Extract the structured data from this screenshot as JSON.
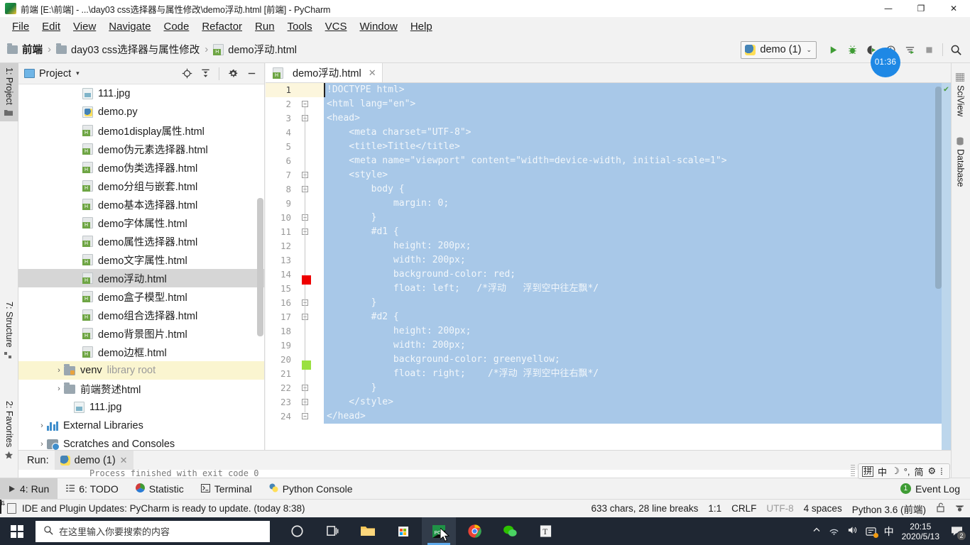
{
  "window": {
    "title": "前端 [E:\\前端] - ...\\day03 css选择器与属性修改\\demo浮动.html [前端] - PyCharm",
    "app_icon": "pycharm-icon",
    "minimize": "—",
    "maximize": "❐",
    "close": "✕"
  },
  "menu": {
    "items": [
      {
        "label": "File"
      },
      {
        "label": "Edit"
      },
      {
        "label": "View"
      },
      {
        "label": "Navigate"
      },
      {
        "label": "Code"
      },
      {
        "label": "Refactor"
      },
      {
        "label": "Run"
      },
      {
        "label": "Tools"
      },
      {
        "label": "VCS"
      },
      {
        "label": "Window"
      },
      {
        "label": "Help"
      }
    ]
  },
  "breadcrumb": {
    "items": [
      {
        "label": "前端",
        "icon": "folder-icon"
      },
      {
        "label": "day03 css选择器与属性修改",
        "icon": "folder-icon"
      },
      {
        "label": "demo浮动.html",
        "icon": "html-file-icon"
      }
    ],
    "separator": "›"
  },
  "toolbar": {
    "run_config": "demo (1)",
    "run_config_caret": "⌄",
    "buttons": [
      "run-icon",
      "debug-icon",
      "coverage-icon",
      "profile-icon",
      "attach-icon",
      "stop-icon",
      "search-everywhere-icon"
    ],
    "timer_badge": "01:36"
  },
  "left_stripe": {
    "items": [
      {
        "label": "1: Project",
        "active": true
      },
      {
        "label": "7: Structure",
        "active": false
      },
      {
        "label": "2: Favorites",
        "active": false
      }
    ]
  },
  "right_stripe": {
    "items": [
      {
        "label": "SciView"
      },
      {
        "label": "Database"
      }
    ]
  },
  "project_panel": {
    "title": "Project",
    "caret": "▾",
    "actions": [
      "locate-icon",
      "collapse-all-icon",
      "settings-icon",
      "hide-icon"
    ],
    "tree": [
      {
        "label": "111.jpg",
        "icon": "image-file-icon",
        "indent": 3,
        "arrow": "",
        "state": "normal"
      },
      {
        "label": "demo.py",
        "icon": "python-file-icon",
        "indent": 3,
        "arrow": "",
        "state": "normal"
      },
      {
        "label": "demo1display属性.html",
        "icon": "html-file-icon",
        "indent": 3,
        "arrow": "",
        "state": "normal"
      },
      {
        "label": "demo伪元素选择器.html",
        "icon": "html-file-icon",
        "indent": 3,
        "arrow": "",
        "state": "normal"
      },
      {
        "label": "demo伪类选择器.html",
        "icon": "html-file-icon",
        "indent": 3,
        "arrow": "",
        "state": "normal"
      },
      {
        "label": "demo分组与嵌套.html",
        "icon": "html-file-icon",
        "indent": 3,
        "arrow": "",
        "state": "normal"
      },
      {
        "label": "demo基本选择器.html",
        "icon": "html-file-icon",
        "indent": 3,
        "arrow": "",
        "state": "normal"
      },
      {
        "label": "demo字体属性.html",
        "icon": "html-file-icon",
        "indent": 3,
        "arrow": "",
        "state": "normal"
      },
      {
        "label": "demo属性选择器.html",
        "icon": "html-file-icon",
        "indent": 3,
        "arrow": "",
        "state": "normal"
      },
      {
        "label": "demo文字属性.html",
        "icon": "html-file-icon",
        "indent": 3,
        "arrow": "",
        "state": "normal"
      },
      {
        "label": "demo浮动.html",
        "icon": "html-file-icon",
        "indent": 3,
        "arrow": "",
        "state": "selected"
      },
      {
        "label": "demo盒子模型.html",
        "icon": "html-file-icon",
        "indent": 3,
        "arrow": "",
        "state": "normal"
      },
      {
        "label": "demo组合选择器.html",
        "icon": "html-file-icon",
        "indent": 3,
        "arrow": "",
        "state": "normal"
      },
      {
        "label": "demo背景图片.html",
        "icon": "html-file-icon",
        "indent": 3,
        "arrow": "",
        "state": "normal"
      },
      {
        "label": "demo边框.html",
        "icon": "html-file-icon",
        "indent": 3,
        "arrow": "",
        "state": "normal"
      },
      {
        "label": "venv",
        "suffix": "library root",
        "icon": "folder-src-icon",
        "indent": 2,
        "arrow": "›",
        "state": "highlight"
      },
      {
        "label": "前端赘述html",
        "icon": "folder-icon",
        "indent": 2,
        "arrow": "›",
        "state": "normal"
      },
      {
        "label": "111.jpg",
        "icon": "image-file-icon",
        "indent": 3,
        "arrow": "",
        "state": "normal"
      },
      {
        "label": "External Libraries",
        "icon": "library-icon",
        "indent": 1,
        "arrow": "›",
        "state": "normal"
      },
      {
        "label": "Scratches and Consoles",
        "icon": "scratches-icon",
        "indent": 1,
        "arrow": "›",
        "state": "normal"
      }
    ]
  },
  "editor": {
    "tab": {
      "label": "demo浮动.html",
      "icon": "html-file-icon",
      "close": "✕"
    },
    "current_line": 1,
    "gutter_swatches": [
      {
        "line": 14,
        "color": "#ee0000"
      },
      {
        "line": 20,
        "color": "#9ae040"
      }
    ],
    "inspection_status": "✔",
    "lines": [
      {
        "n": 1,
        "text": "!DOCTYPE html>",
        "fold": ""
      },
      {
        "n": 2,
        "text": "<html lang=\"en\">",
        "fold": "−"
      },
      {
        "n": 3,
        "text": "<head>",
        "fold": "−"
      },
      {
        "n": 4,
        "text": "    <meta charset=\"UTF-8\">",
        "fold": ""
      },
      {
        "n": 5,
        "text": "    <title>Title</title>",
        "fold": ""
      },
      {
        "n": 6,
        "text": "    <meta name=\"viewport\" content=\"width=device-width, initial-scale=1\">",
        "fold": ""
      },
      {
        "n": 7,
        "text": "    <style>",
        "fold": "−"
      },
      {
        "n": 8,
        "text": "        body {",
        "fold": "−"
      },
      {
        "n": 9,
        "text": "            margin: 0;",
        "fold": ""
      },
      {
        "n": 10,
        "text": "        }",
        "fold": "−"
      },
      {
        "n": 11,
        "text": "        #d1 {",
        "fold": "−"
      },
      {
        "n": 12,
        "text": "            height: 200px;",
        "fold": ""
      },
      {
        "n": 13,
        "text": "            width: 200px;",
        "fold": ""
      },
      {
        "n": 14,
        "text": "            background-color: red;",
        "fold": ""
      },
      {
        "n": 15,
        "text": "            float: left;   /*浮动   浮到空中往左飘*/",
        "fold": ""
      },
      {
        "n": 16,
        "text": "        }",
        "fold": "−"
      },
      {
        "n": 17,
        "text": "        #d2 {",
        "fold": "−"
      },
      {
        "n": 18,
        "text": "            height: 200px;",
        "fold": ""
      },
      {
        "n": 19,
        "text": "            width: 200px;",
        "fold": ""
      },
      {
        "n": 20,
        "text": "            background-color: greenyellow;",
        "fold": ""
      },
      {
        "n": 21,
        "text": "            float: right;    /*浮动 浮到空中往右飘*/",
        "fold": ""
      },
      {
        "n": 22,
        "text": "        }",
        "fold": "−"
      },
      {
        "n": 23,
        "text": "    </style>",
        "fold": "−"
      },
      {
        "n": 24,
        "text": "</head>",
        "fold": "−"
      }
    ]
  },
  "run_window": {
    "label": "Run:",
    "tab": "demo (1)",
    "tab_close": "✕",
    "console_text": "Process finished with exit code 0"
  },
  "bottom_stripe": {
    "items": [
      {
        "label": "4: Run",
        "icon": "run-small-icon",
        "active": true
      },
      {
        "label": "6: TODO",
        "icon": "todo-icon",
        "active": false
      },
      {
        "label": "Statistic",
        "icon": "statistic-icon",
        "active": false
      },
      {
        "label": "Terminal",
        "icon": "terminal-icon",
        "active": false
      },
      {
        "label": "Python Console",
        "icon": "python-icon",
        "active": false
      }
    ],
    "event_log": {
      "label": "Event Log",
      "count": "1"
    }
  },
  "ime_bar": {
    "items": [
      "拼",
      "中",
      "☽",
      "°,",
      "简",
      "⚙",
      "⁞"
    ]
  },
  "statusbar": {
    "message": "IDE and Plugin Updates: PyCharm is ready to update. (today 8:38)",
    "chars": "633 chars, 28 line breaks",
    "caret_pos": "1:1",
    "line_sep": "CRLF",
    "encoding": "UTF-8",
    "indent": "4 spaces",
    "interpreter": "Python 3.6 (前端)",
    "lock_icon": "unlock-icon",
    "hector_icon": "hector-icon"
  },
  "taskbar": {
    "search_placeholder": "在这里输入你要搜索的内容",
    "apps": [
      {
        "name": "cortana-icon"
      },
      {
        "name": "task-view-icon"
      },
      {
        "name": "file-explorer-icon"
      },
      {
        "name": "microsoft-store-icon"
      },
      {
        "name": "pycharm-icon"
      },
      {
        "name": "chrome-icon"
      },
      {
        "name": "wechat-icon"
      },
      {
        "name": "typora-icon"
      }
    ],
    "tray": [
      "chevron-up-icon",
      "network-icon",
      "volume-icon",
      "input-method-icon",
      "中"
    ],
    "time": "20:15",
    "date": "2020/5/13",
    "notification_count": "2"
  }
}
